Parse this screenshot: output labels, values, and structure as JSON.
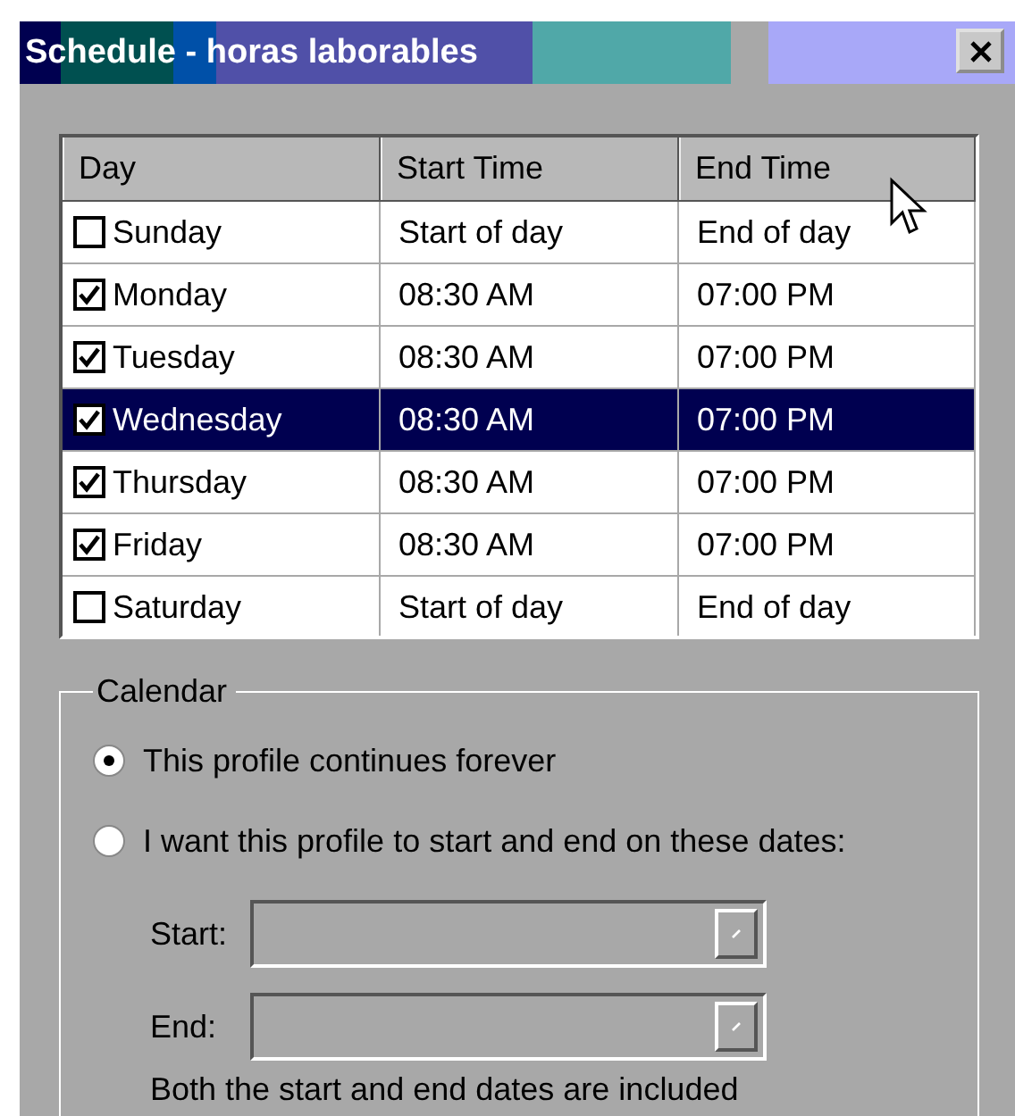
{
  "window": {
    "title": "Schedule - horas laborables"
  },
  "table": {
    "columns": [
      "Day",
      "Start Time",
      "End Time"
    ],
    "rows": [
      {
        "day": "Sunday",
        "checked": false,
        "selected": false,
        "start": "Start of day",
        "end": "End of day"
      },
      {
        "day": "Monday",
        "checked": true,
        "selected": false,
        "start": "08:30 AM",
        "end": "07:00 PM"
      },
      {
        "day": "Tuesday",
        "checked": true,
        "selected": false,
        "start": "08:30 AM",
        "end": "07:00 PM"
      },
      {
        "day": "Wednesday",
        "checked": true,
        "selected": true,
        "start": "08:30 AM",
        "end": "07:00 PM"
      },
      {
        "day": "Thursday",
        "checked": true,
        "selected": false,
        "start": "08:30 AM",
        "end": "07:00 PM"
      },
      {
        "day": "Friday",
        "checked": true,
        "selected": false,
        "start": "08:30 AM",
        "end": "07:00 PM"
      },
      {
        "day": "Saturday",
        "checked": false,
        "selected": false,
        "start": "Start of day",
        "end": "End of day"
      }
    ]
  },
  "calendar": {
    "title": "Calendar",
    "options": [
      {
        "label": "This profile continues forever",
        "selected": true
      },
      {
        "label": "I want this profile to start and end on these dates:",
        "selected": false
      }
    ],
    "fields": [
      {
        "label": "Start:",
        "disabled": true
      },
      {
        "label": "End:",
        "disabled": true
      }
    ],
    "note": "Both the start and end dates are included"
  }
}
